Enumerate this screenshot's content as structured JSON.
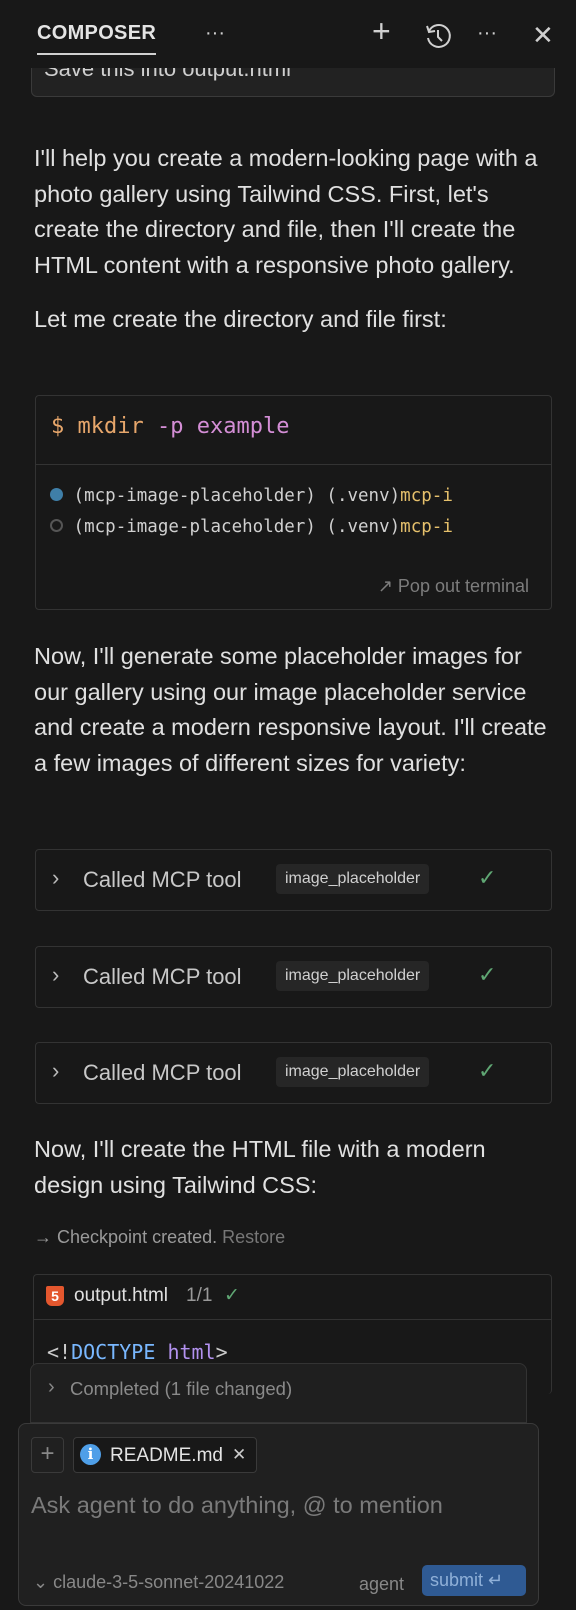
{
  "header": {
    "tab": "COMPOSER",
    "tab_menu": "···",
    "icons": [
      "plus-icon",
      "history-icon",
      "more-icon",
      "close-icon"
    ]
  },
  "previous_message": "Save this into output.html",
  "messages": {
    "p1": "I'll help you create a modern-looking page with a photo gallery using Tailwind CSS. First, let's create the directory and file, then I'll create the HTML content with a responsive photo gallery.",
    "p2": "Let me create the directory and file first:",
    "p3": "Now, I'll generate some placeholder images for our gallery using our image placeholder service and create a modern responsive layout. I'll create a few images of different sizes for variety:",
    "p4": "Now, I'll create the HTML file with a modern design using Tailwind CSS:"
  },
  "terminal": {
    "prompt": "$",
    "cmd": "mkdir",
    "args": "-p example",
    "lines": [
      {
        "a": "(mcp-image-placeholder) (.venv)",
        "b": "mcp-i"
      },
      {
        "a": "(mcp-image-placeholder) (.venv)",
        "b": "mcp-i"
      }
    ],
    "pop_out": "Pop out terminal"
  },
  "tool_calls": [
    {
      "label": "Called MCP tool",
      "tool": "image_placeholder"
    },
    {
      "label": "Called MCP tool",
      "tool": "image_placeholder"
    },
    {
      "label": "Called MCP tool",
      "tool": "image_placeholder"
    }
  ],
  "checkpoint": {
    "text": "Checkpoint created.",
    "restore": "Restore"
  },
  "file": {
    "name": "output.html",
    "count": "1/1",
    "code_a": "<!",
    "code_b": "DOCTYPE",
    "code_c": "html",
    ">": ">"
  },
  "completed": "Completed (1 file changed)",
  "input": {
    "chip": "README.md",
    "placeholder": "Ask agent to do anything, @ to mention",
    "model": "claude-3-5-sonnet-20241022",
    "mode": "agent",
    "submit": "submit"
  },
  "colors": {
    "bg": "#181818",
    "accent": "#2f5a93",
    "check": "#5fa673",
    "html_icon": "#e4572e"
  }
}
